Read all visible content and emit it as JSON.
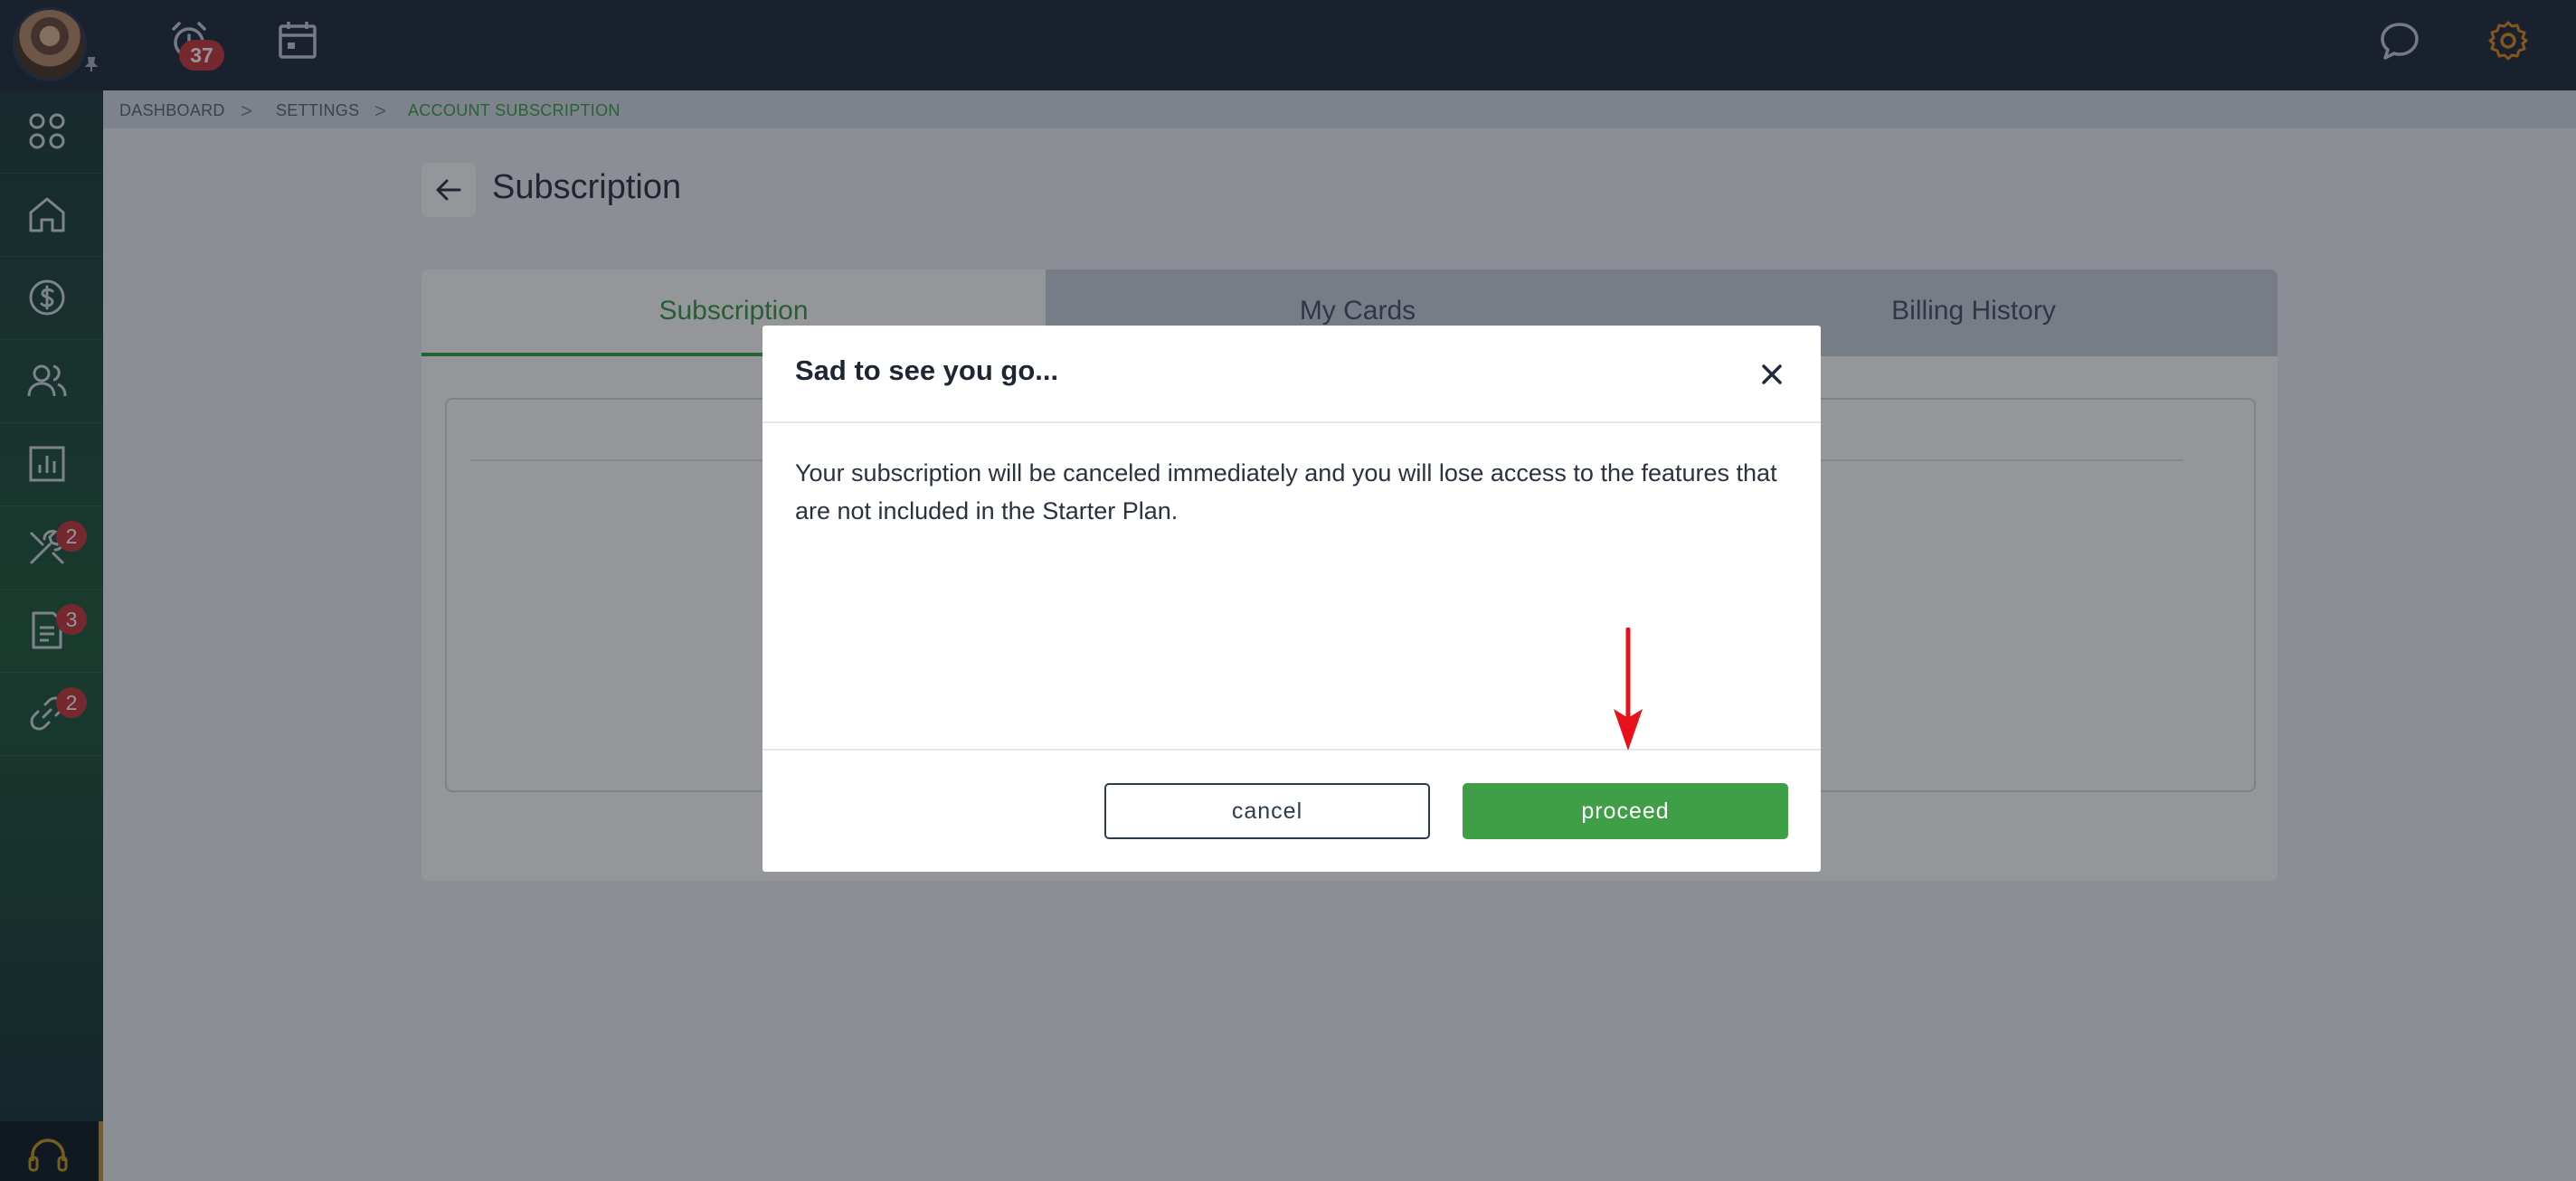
{
  "topbar": {
    "notifications_count": "37"
  },
  "sidebar": {
    "items": [
      {
        "name": "apps",
        "badge": ""
      },
      {
        "name": "home",
        "badge": ""
      },
      {
        "name": "payments",
        "badge": ""
      },
      {
        "name": "contacts",
        "badge": ""
      },
      {
        "name": "reports",
        "badge": ""
      },
      {
        "name": "tools",
        "badge": "2"
      },
      {
        "name": "documents",
        "badge": "3"
      },
      {
        "name": "integrations",
        "badge": "2"
      }
    ]
  },
  "breadcrumb": {
    "items": [
      "DASHBOARD",
      "SETTINGS",
      "ACCOUNT SUBSCRIPTION"
    ],
    "separator": ">"
  },
  "page": {
    "title": "Subscription"
  },
  "tabs": [
    {
      "label": "Subscription",
      "active": true
    },
    {
      "label": "My Cards",
      "active": false
    },
    {
      "label": "Billing History",
      "active": false
    }
  ],
  "modal": {
    "title": "Sad to see you go...",
    "body": "Your subscription will be canceled immediately and you will lose access to the features that are not included in the Starter Plan.",
    "cancel_label": "cancel",
    "proceed_label": "proceed",
    "close_icon": "close-icon"
  },
  "colors": {
    "accent": "#3f9f47",
    "badge": "#c9373d",
    "topbar": "#1f2a3c",
    "annotation_arrow": "#e8101a"
  }
}
